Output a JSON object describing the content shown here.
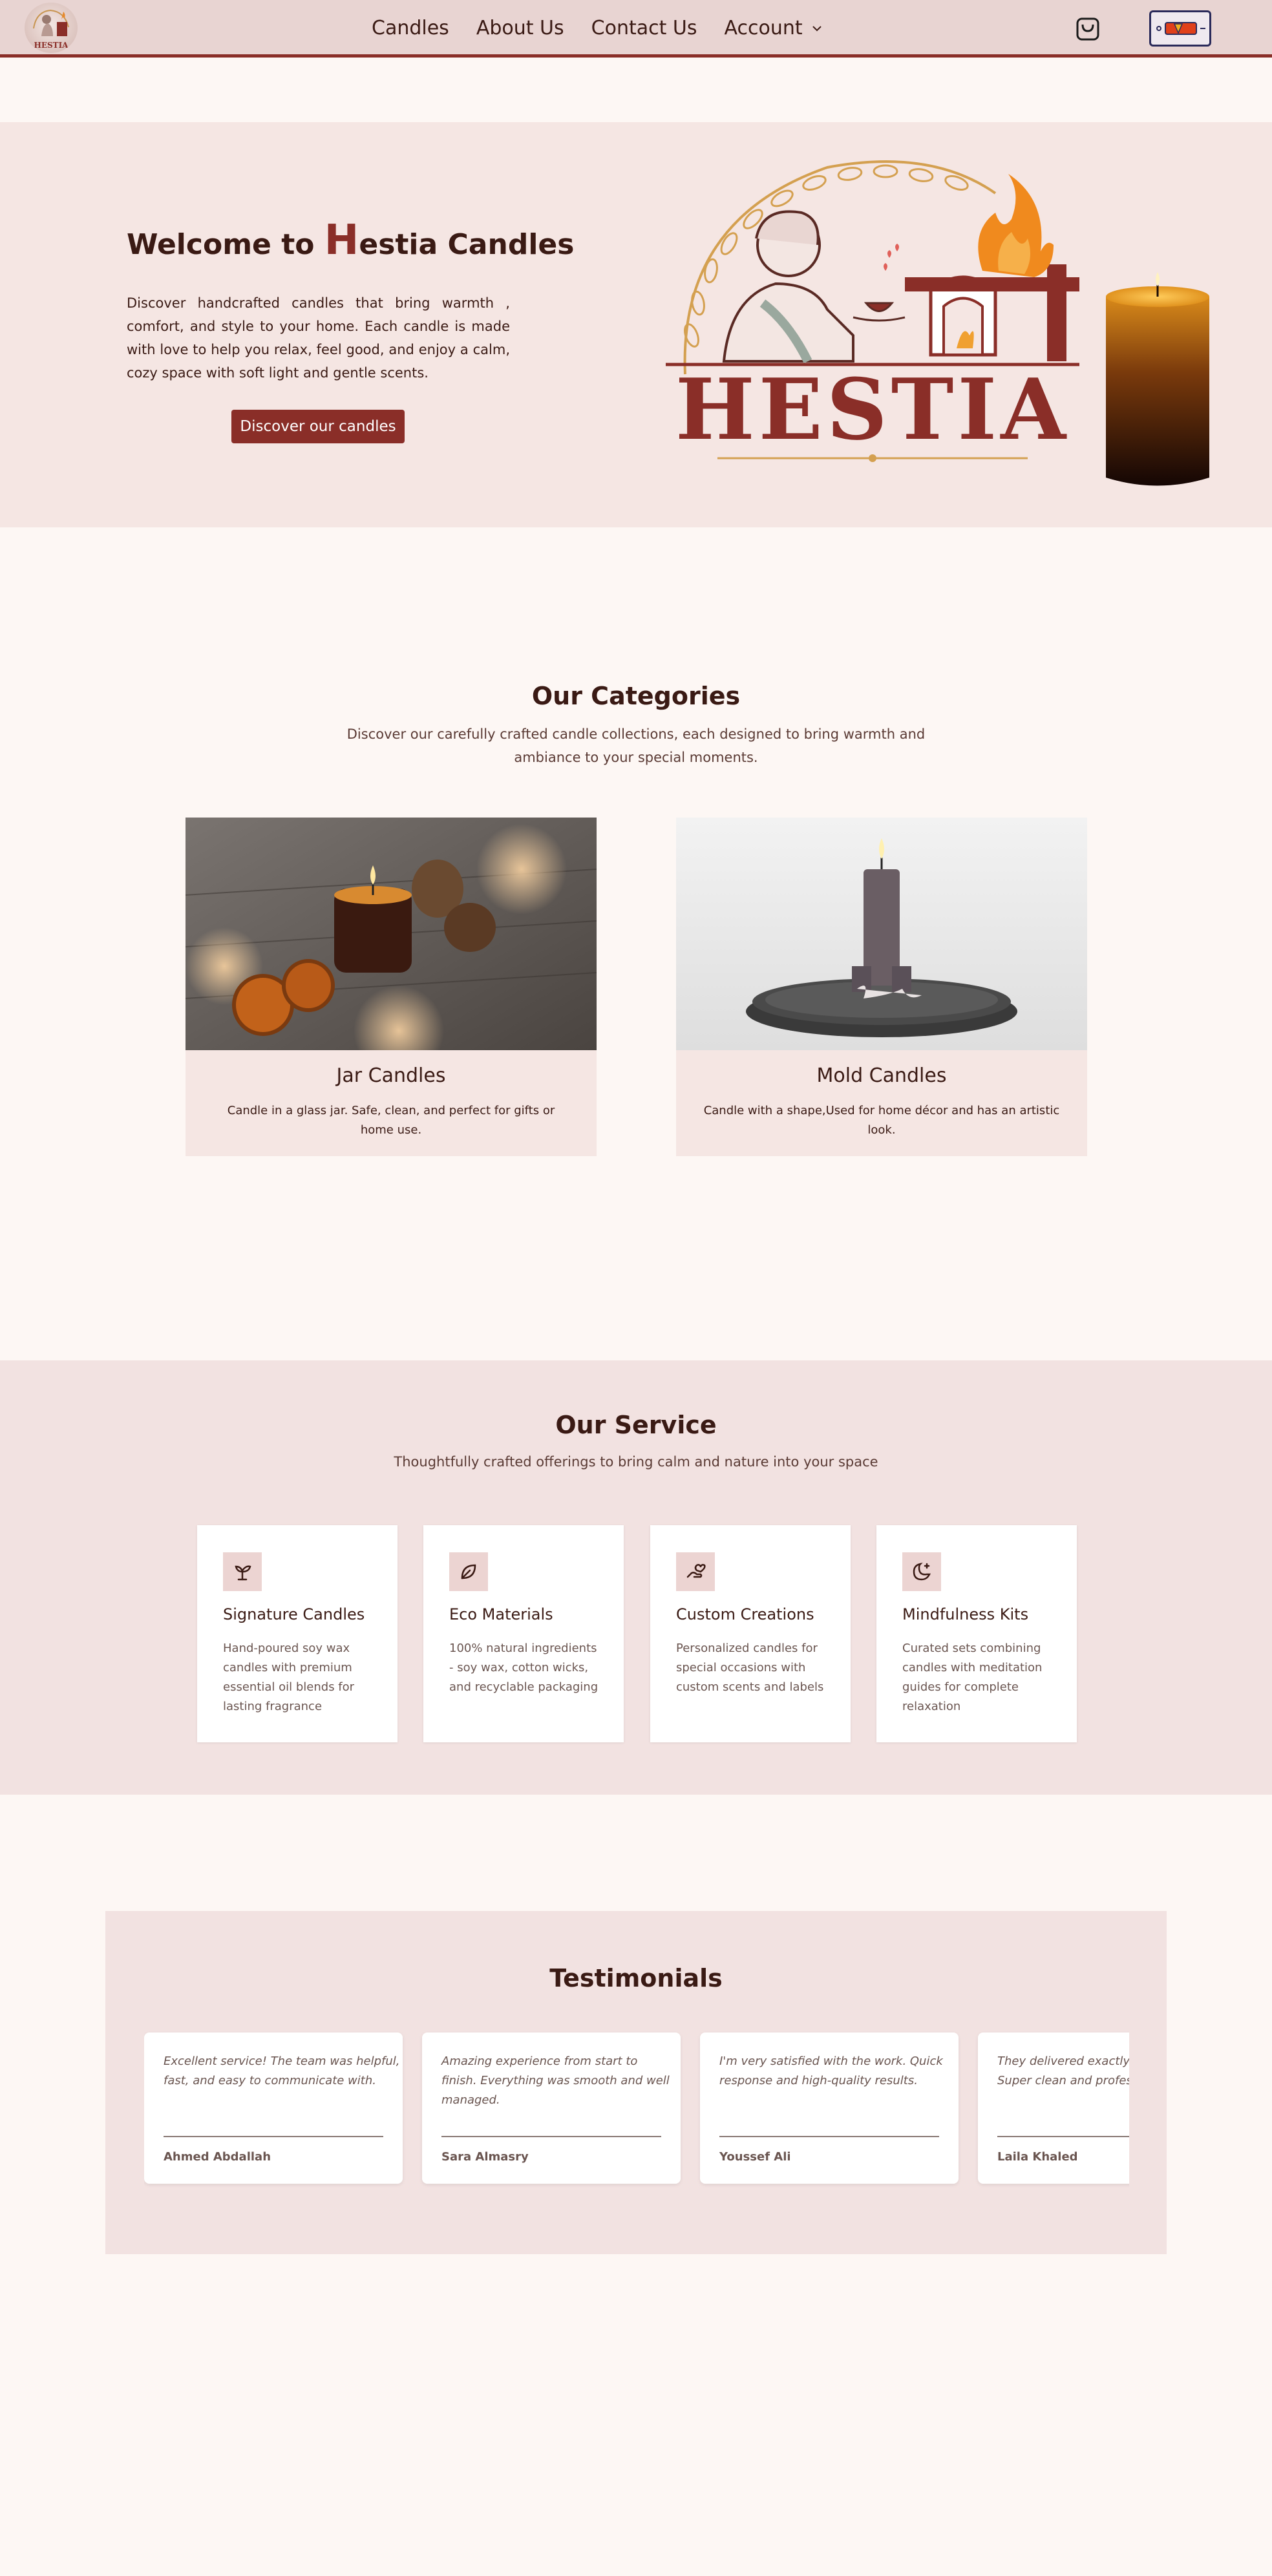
{
  "nav": {
    "links": [
      "Candles",
      "About Us",
      "Contact Us",
      "Account"
    ],
    "logo_text": "HESTIA"
  },
  "hero": {
    "title_prefix": "Welcome to ",
    "title_big_letter": "H",
    "title_suffix": "estia Candles",
    "text": "Discover handcrafted candles that bring warmth , comfort, and style to your home. Each candle is made with love to help you relax, feel good, and enjoy a calm, cozy space with soft light and gentle scents.",
    "button": "Discover our candles",
    "logo_wordmark": "HESTIA"
  },
  "categories": {
    "title": "Our Categories",
    "subtitle_line1": "Discover our carefully crafted candle collections, each designed to bring warmth and",
    "subtitle_line2": "ambiance to your special moments.",
    "items": [
      {
        "name": "Jar Candles",
        "desc": "Candle in a glass jar. Safe, clean, and perfect for gifts or home use."
      },
      {
        "name": "Mold Candles",
        "desc": "Candle with a shape,Used for home décor and has an artistic look."
      }
    ]
  },
  "services": {
    "title": "Our Service",
    "subtitle": "Thoughtfully crafted offerings to bring calm and nature into your space",
    "items": [
      {
        "icon": "sprout-icon",
        "title": "Signature Candles",
        "desc": "Hand-poured soy wax candles with premium essential oil blends for lasting fragrance"
      },
      {
        "icon": "leaf-icon",
        "title": "Eco Materials",
        "desc": "100% natural ingredients - soy wax, cotton wicks, and recyclable packaging"
      },
      {
        "icon": "hand-heart-icon",
        "title": "Custom Creations",
        "desc": "Personalized candles for special occasions with custom scents and labels"
      },
      {
        "icon": "moon-star-icon",
        "title": "Mindfulness Kits",
        "desc": "Curated sets combining candles with meditation guides for complete relaxation"
      }
    ]
  },
  "testimonials": {
    "title": "Testimonials",
    "items": [
      {
        "lines": [
          "Excellent service! The team was helpful,",
          "fast, and easy to communicate with."
        ],
        "name": "Ahmed Abdallah"
      },
      {
        "lines": [
          "Amazing experience from start to",
          "finish. Everything was smooth and well",
          "managed."
        ],
        "name": "Sara Almasry"
      },
      {
        "lines": [
          "I'm very satisfied with the work. Quick",
          "response and high-quality results."
        ],
        "name": "Youssef Ali"
      },
      {
        "lines": [
          "They delivered exactly what I needed.",
          "Super clean and professional work."
        ],
        "name": "Laila Khaled"
      }
    ]
  },
  "colors": {
    "accent": "#8a2e28",
    "nav_bg": "#e8d4d2",
    "hero_bg": "#f5e6e3",
    "page_bg": "#fdf7f4"
  }
}
